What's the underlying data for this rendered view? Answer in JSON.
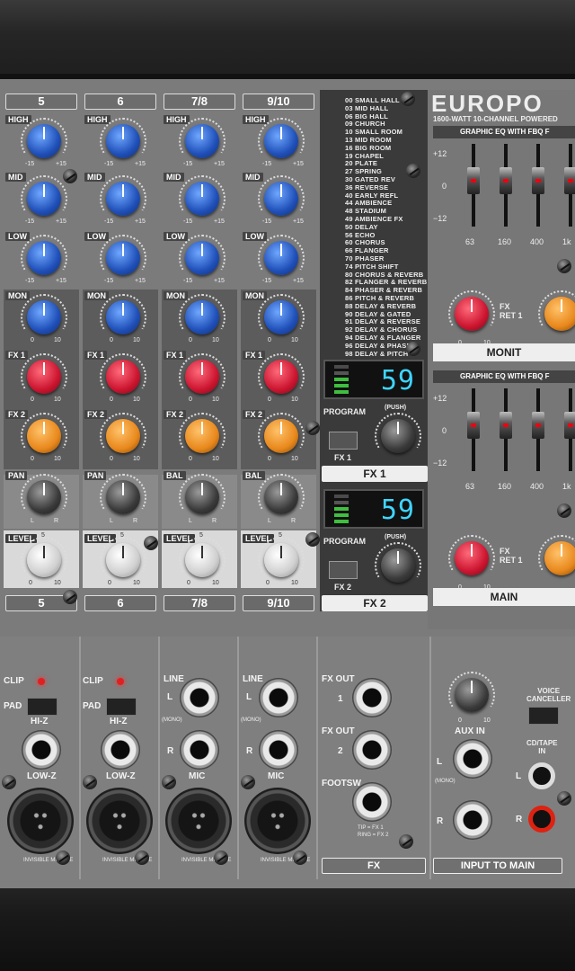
{
  "channels": [
    {
      "top": "5",
      "bottom": "5",
      "pan": "PAN"
    },
    {
      "top": "6",
      "bottom": "6",
      "pan": "PAN"
    },
    {
      "top": "7/8",
      "bottom": "7/8",
      "pan": "BAL"
    },
    {
      "top": "9/10",
      "bottom": "9/10",
      "pan": "BAL"
    }
  ],
  "controls": {
    "high": "HIGH",
    "mid": "MID",
    "low": "LOW",
    "mon": "MON",
    "fx1": "FX 1",
    "fx2": "FX 2",
    "level": "LEVEL",
    "eq_min": "-15",
    "eq_max": "+15",
    "send_min": "0",
    "send_max": "10",
    "level_mid": "5",
    "pan_l": "L",
    "pan_r": "R"
  },
  "presets": [
    "00 SMALL HALL",
    "03 MID HALL",
    "06 BIG HALL",
    "09 CHURCH",
    "10 SMALL ROOM",
    "13 MID ROOM",
    "16 BIG ROOM",
    "19 CHAPEL",
    "20 PLATE",
    "27 SPRING",
    "30 GATED REV",
    "36 REVERSE",
    "40 EARLY REFL",
    "44 AMBIENCE",
    "48 STADIUM",
    "49 AMBIENCE FX",
    "50 DELAY",
    "56 ECHO",
    "60 CHORUS",
    "66 FLANGER",
    "70 PHASER",
    "74 PITCH SHIFT",
    "80 CHORUS & REVERB",
    "82 FLANGER & REVERB",
    "84 PHASER & REVERB",
    "86 PITCH & REVERB",
    "88 DELAY & REVERB",
    "90 DELAY & GATED",
    "91 DELAY & REVERSE",
    "92 DELAY & CHORUS",
    "94 DELAY & FLANGER",
    "96 DELAY & PHASER",
    "98 DELAY & PITCH"
  ],
  "fx_units": [
    {
      "display": "59",
      "program": "PROGRAM",
      "push": "(PUSH)",
      "button": "FX 1",
      "label": "FX 1"
    },
    {
      "display": "59",
      "program": "PROGRAM",
      "push": "(PUSH)",
      "button": "FX 2",
      "label": "FX 2"
    }
  ],
  "right": {
    "brand": "EUROPO",
    "subtitle": "1600-WATT 10-CHANNEL POWERED",
    "eq_header": "GRAPHIC EQ WITH FBQ F",
    "eq_plus": "+12",
    "eq_zero": "0",
    "eq_minus": "−12",
    "bands": [
      "63",
      "160",
      "400",
      "1k"
    ],
    "fx_ret": "FX\nRET 1",
    "fx_ret_min": "0",
    "fx_ret_max": "10",
    "monitor_label": "MONIT",
    "main_label": "MAIN"
  },
  "inputs": {
    "clip": "CLIP",
    "pad": "PAD",
    "hiz": "HI-Z",
    "lowz": "LOW-Z",
    "line": "LINE",
    "mono": "(MONO)",
    "mic": "MIC",
    "invisible": "INVISIBLE MIC PRE",
    "jack_l": "L",
    "jack_r": "R"
  },
  "fx_io": {
    "fx_out": "FX OUT",
    "n1": "1",
    "n2": "2",
    "footsw": "FOOTSW",
    "tip": "TIP = FX 1",
    "ring": "RING = FX 2",
    "label": "FX"
  },
  "input_main": {
    "aux_in": "AUX IN",
    "aux_min": "0",
    "aux_max": "10",
    "l": "L",
    "mono": "(MONO)",
    "r": "R",
    "label": "INPUT TO MAIN",
    "voice": "VOICE\nCANCELLER",
    "cd": "CD/TAPE\nIN",
    "cd_l": "L",
    "cd_r": "R"
  }
}
